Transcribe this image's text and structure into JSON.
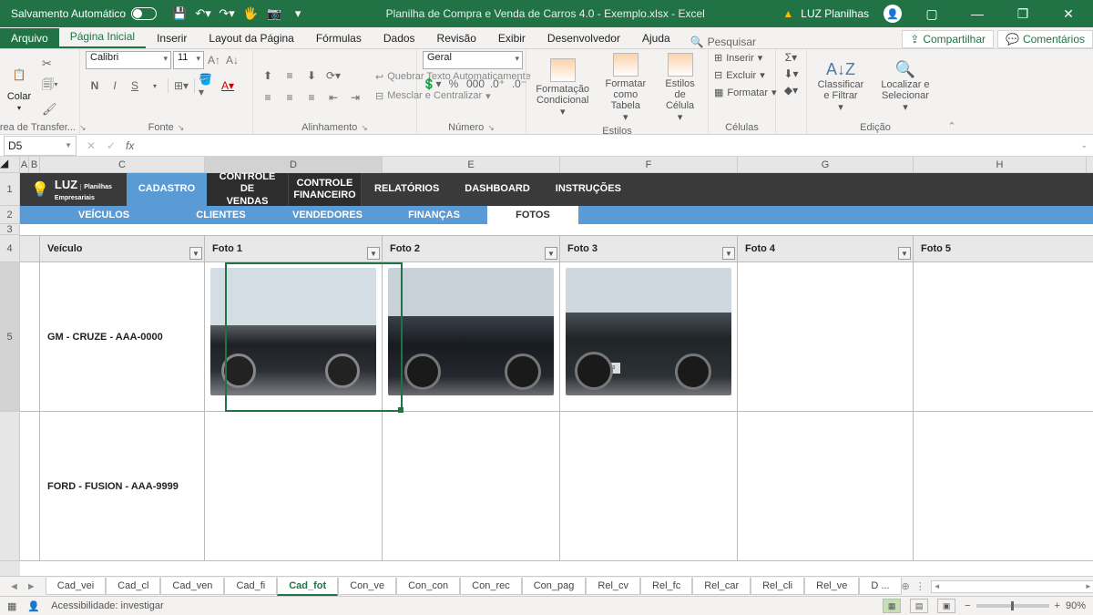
{
  "titlebar": {
    "autosave": "Salvamento Automático",
    "filename": "Planilha de Compra e Venda de Carros 4.0 - Exemplo.xlsx  -  Excel",
    "brand": "LUZ Planilhas"
  },
  "ribtabs": {
    "file": "Arquivo",
    "home": "Página Inicial",
    "insert": "Inserir",
    "layout": "Layout da Página",
    "formulas": "Fórmulas",
    "data": "Dados",
    "review": "Revisão",
    "view": "Exibir",
    "dev": "Desenvolvedor",
    "help": "Ajuda",
    "search": "Pesquisar",
    "share": "Compartilhar",
    "comments": "Comentários"
  },
  "ribbon": {
    "clipboard": {
      "paste": "Colar",
      "label": "Área de Transfer..."
    },
    "font": {
      "name": "Calibri",
      "size": "11",
      "label": "Fonte"
    },
    "align": {
      "wrap": "Quebrar Texto Automaticamente",
      "merge": "Mesclar e Centralizar",
      "label": "Alinhamento"
    },
    "number": {
      "format": "Geral",
      "label": "Número"
    },
    "styles": {
      "cond": "Formatação Condicional",
      "table": "Formatar como Tabela",
      "cell": "Estilos de Célula",
      "label": "Estilos"
    },
    "cells": {
      "insert": "Inserir",
      "delete": "Excluir",
      "format": "Formatar",
      "label": "Células"
    },
    "edit": {
      "sort": "Classificar e Filtrar",
      "find": "Localizar e Selecionar",
      "label": "Edição"
    }
  },
  "fbar": {
    "cell": "D5"
  },
  "cols": {
    "a": "A",
    "b": "B",
    "c": "C",
    "d": "D",
    "e": "E",
    "f": "F",
    "g": "G",
    "h": "H"
  },
  "rows": {
    "r1": "1",
    "r2": "2",
    "r3": "3",
    "r4": "4",
    "r5": "5"
  },
  "nav": {
    "logo": "LUZ",
    "logosub": "Planilhas\nEmpresariais",
    "cadastro": "CADASTRO",
    "vendas": "CONTROLE DE VENDAS",
    "fin": "CONTROLE FINANCEIRO",
    "rel": "RELATÓRIOS",
    "dash": "DASHBOARD",
    "inst": "INSTRUÇÕES"
  },
  "subnav": {
    "veiculos": "VEÍCULOS",
    "clientes": "CLIENTES",
    "vendedores": "VENDEDORES",
    "financas": "FINANÇAS",
    "fotos": "FOTOS"
  },
  "table": {
    "veiculo": "Veículo",
    "foto1": "Foto 1",
    "foto2": "Foto 2",
    "foto3": "Foto 3",
    "foto4": "Foto 4",
    "foto5": "Foto 5",
    "row1": "GM - CRUZE - AAA-0000",
    "row2": "FORD - FUSION - AAA-9999",
    "plate": "EZX-3343"
  },
  "sheets": {
    "s1": "Cad_vei",
    "s2": "Cad_cl",
    "s3": "Cad_ven",
    "s4": "Cad_fi",
    "s5": "Cad_fot",
    "s6": "Con_ve",
    "s7": "Con_con",
    "s8": "Con_rec",
    "s9": "Con_pag",
    "s10": "Rel_cv",
    "s11": "Rel_fc",
    "s12": "Rel_car",
    "s13": "Rel_cli",
    "s14": "Rel_ve",
    "s15": "D  ..."
  },
  "status": {
    "acc": "Acessibilidade: investigar",
    "zoom": "90%"
  }
}
